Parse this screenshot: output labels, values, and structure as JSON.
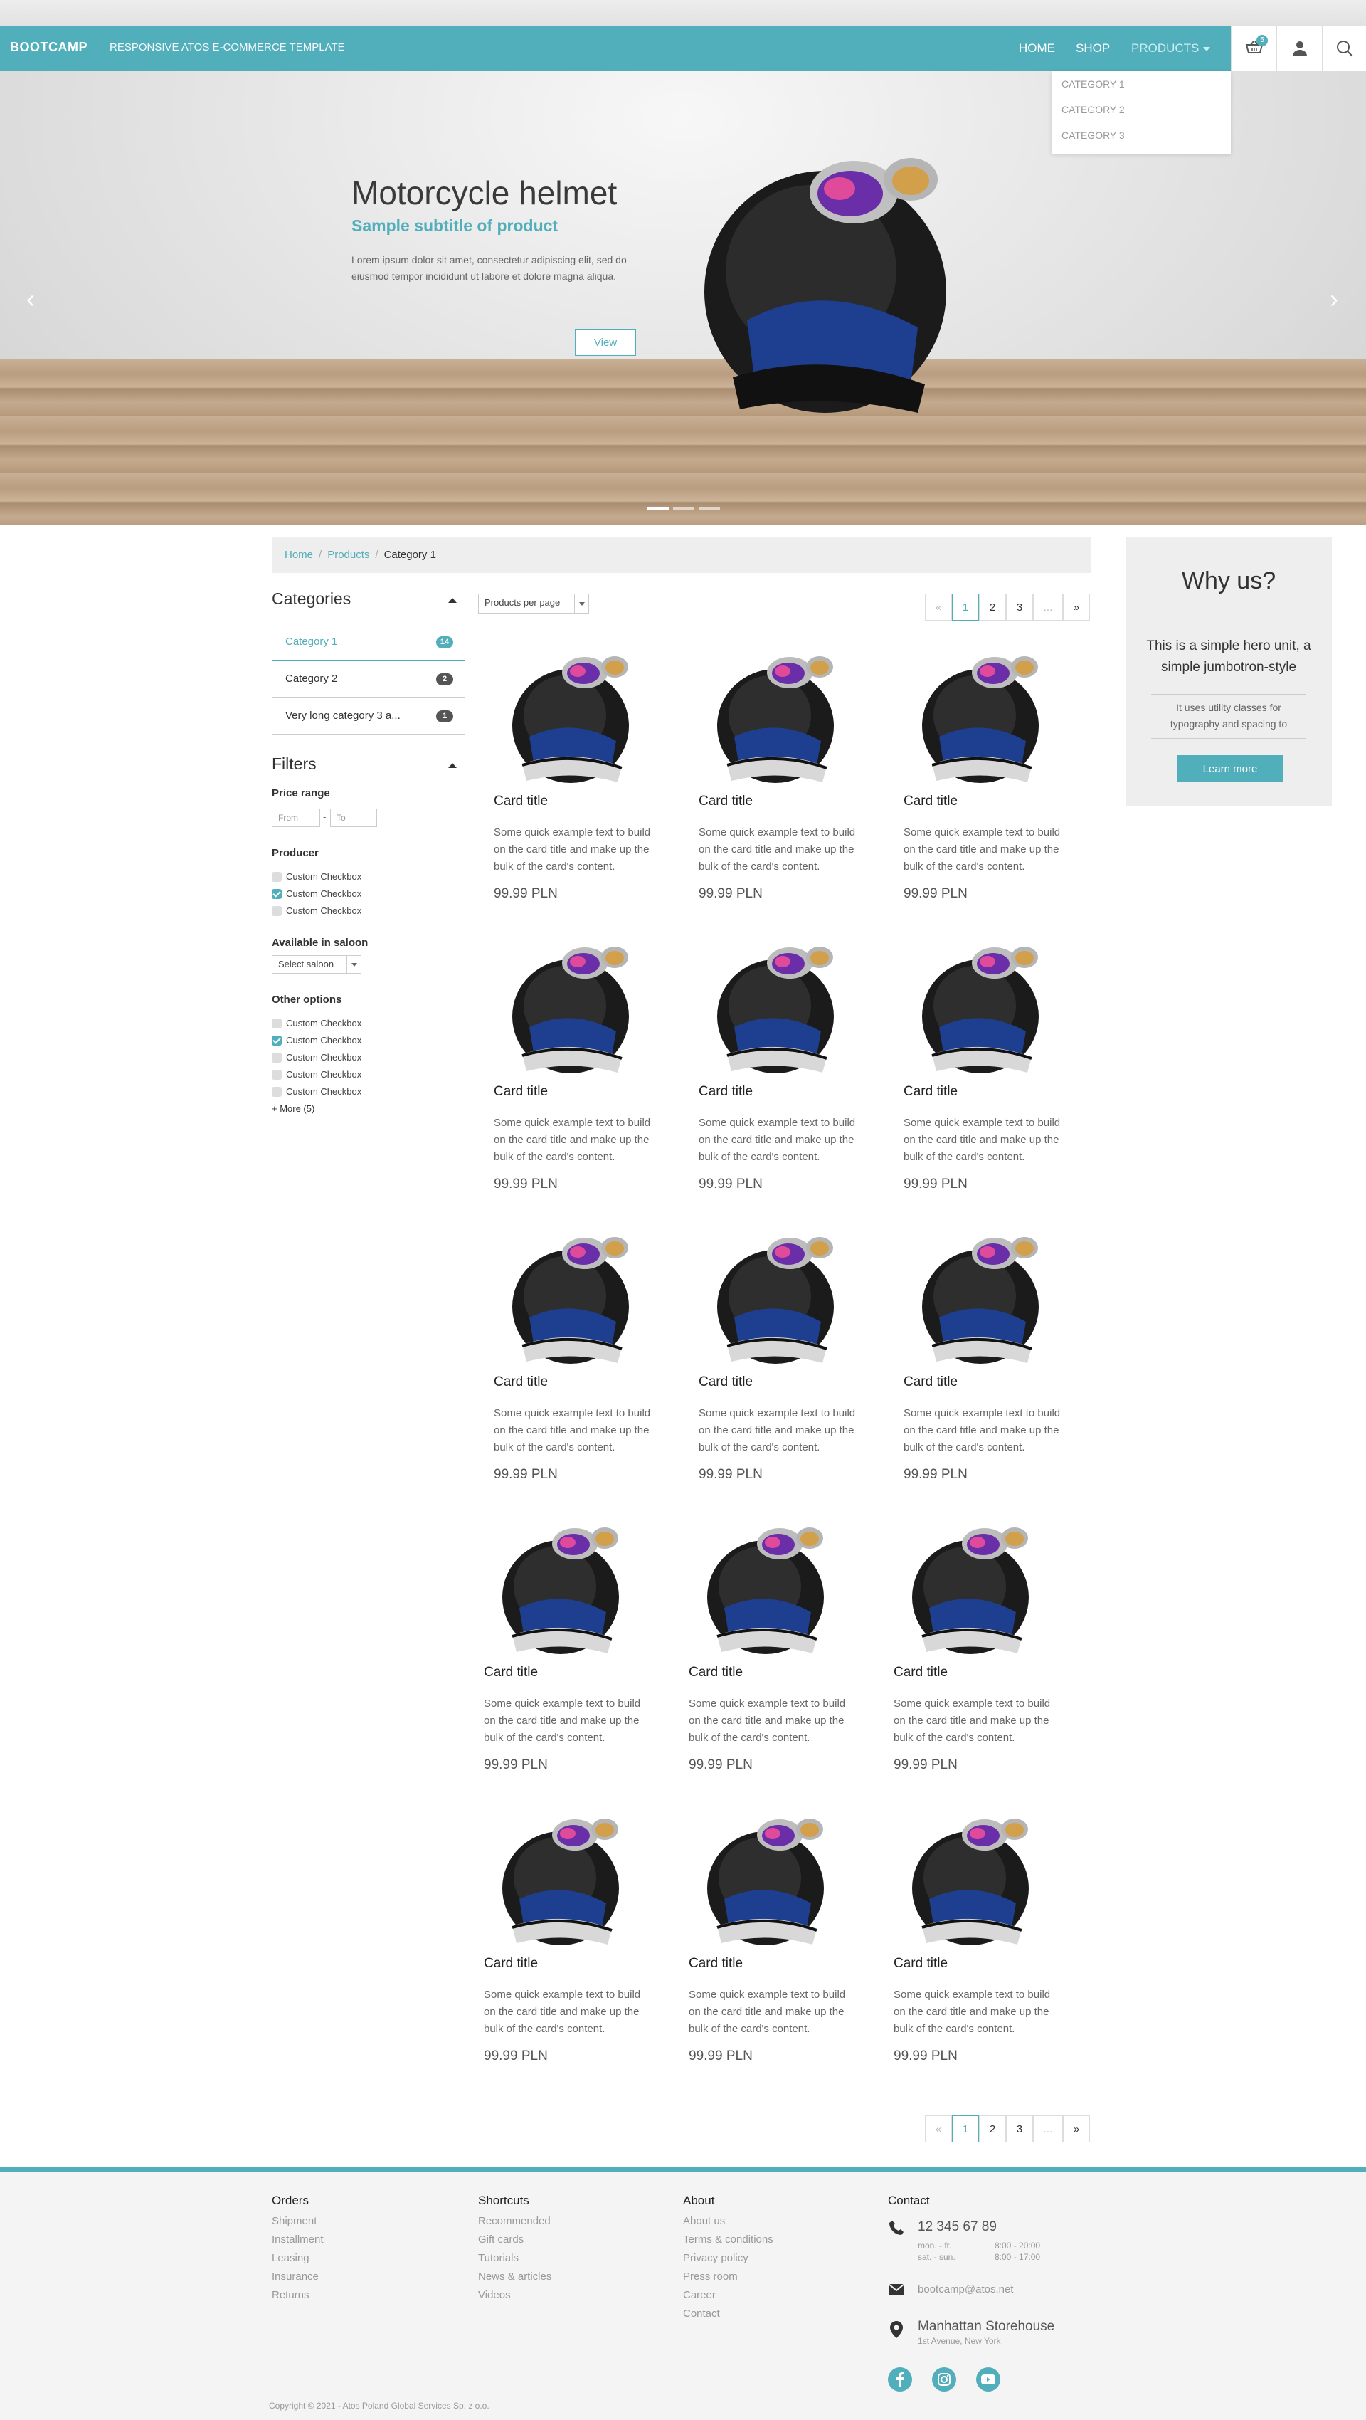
{
  "navbar": {
    "brand": "BOOTCAMP",
    "tagline": "RESPONSIVE ATOS E-COMMERCE TEMPLATE",
    "links": [
      "HOME",
      "SHOP",
      "PRODUCTS"
    ],
    "cart_count": "5",
    "products_dropdown": [
      "CATEGORY 1",
      "CATEGORY 2",
      "CATEGORY 3"
    ],
    "icons": [
      "cart-icon",
      "user-icon",
      "search-icon"
    ]
  },
  "hero": {
    "title": "Motorcycle helmet",
    "subtitle": "Sample subtitle of product",
    "text": "Lorem ipsum dolor sit amet, consectetur adipiscing elit, sed do eiusmod tempor incididunt ut labore et dolore magna aliqua.",
    "button": "View",
    "slide_count": 3,
    "active_slide": 1
  },
  "breadcrumb": [
    "Home",
    "Products",
    "Category 1"
  ],
  "sidebar": {
    "categories_title": "Categories",
    "categories": [
      {
        "label": "Category 1",
        "count": "14"
      },
      {
        "label": "Category 2",
        "count": "2"
      },
      {
        "label": "Very long category 3 a...",
        "count": "1"
      }
    ],
    "filters_title": "Filters",
    "price_range": {
      "label": "Price range",
      "from_placeholder": "From",
      "to_placeholder": "To",
      "separator": "-"
    },
    "producer": {
      "label": "Producer",
      "options": [
        {
          "label": "Custom Checkbox",
          "checked": false
        },
        {
          "label": "Custom Checkbox",
          "checked": true
        },
        {
          "label": "Custom Checkbox",
          "checked": false
        }
      ]
    },
    "saloon": {
      "label": "Available in saloon",
      "value": "Select saloon"
    },
    "other": {
      "label": "Other options",
      "options": [
        {
          "label": "Custom Checkbox",
          "checked": false
        },
        {
          "label": "Custom Checkbox",
          "checked": true
        },
        {
          "label": "Custom Checkbox",
          "checked": false
        },
        {
          "label": "Custom Checkbox",
          "checked": false
        },
        {
          "label": "Custom Checkbox",
          "checked": false
        }
      ],
      "more": "+ More (5)"
    }
  },
  "toolbar": {
    "per_page": "Products per page"
  },
  "pagination": {
    "prev": "«",
    "pages": [
      "1",
      "2",
      "3"
    ],
    "ellipsis": "...",
    "next": "»",
    "active": "1"
  },
  "products": [
    {
      "title": "Card title",
      "text": "Some quick example text to build on the card title and make up the bulk of the card's content.",
      "price": "99.99 PLN"
    },
    {
      "title": "Card title",
      "text": "Some quick example text to build on the card title and make up the bulk of the card's content.",
      "price": "99.99 PLN"
    },
    {
      "title": "Card title",
      "text": "Some quick example text to build on the card title and make up the bulk of the card's content.",
      "price": "99.99 PLN"
    },
    {
      "title": "Card title",
      "text": "Some quick example text to build on the card title and make up the bulk of the card's content.",
      "price": "99.99 PLN"
    },
    {
      "title": "Card title",
      "text": "Some quick example text to build on the card title and make up the bulk of the card's content.",
      "price": "99.99 PLN"
    },
    {
      "title": "Card title",
      "text": "Some quick example text to build on the card title and make up the bulk of the card's content.",
      "price": "99.99 PLN"
    },
    {
      "title": "Card title",
      "text": "Some quick example text to build on the card title and make up the bulk of the card's content.",
      "price": "99.99 PLN"
    },
    {
      "title": "Card title",
      "text": "Some quick example text to build on the card title and make up the bulk of the card's content.",
      "price": "99.99 PLN"
    },
    {
      "title": "Card title",
      "text": "Some quick example text to build on the card title and make up the bulk of the card's content.",
      "price": "99.99 PLN"
    },
    {
      "title": "Card title",
      "text": "Some quick example text to build on the card title and make up the bulk of the card's content.",
      "price": "99.99 PLN"
    },
    {
      "title": "Card title",
      "text": "Some quick example text to build on the card title and make up the bulk of the card's content.",
      "price": "99.99 PLN"
    },
    {
      "title": "Card title",
      "text": "Some quick example text to build on the card title and make up the bulk of the card's content.",
      "price": "99.99 PLN"
    },
    {
      "title": "Card title",
      "text": "Some quick example text to build on the card title and make up the bulk of the card's content.",
      "price": "99.99 PLN"
    },
    {
      "title": "Card title",
      "text": "Some quick example text to build on the card title and make up the bulk of the card's content.",
      "price": "99.99 PLN"
    },
    {
      "title": "Card title",
      "text": "Some quick example text to build on the card title and make up the bulk of the card's content.",
      "price": "99.99 PLN"
    }
  ],
  "why": {
    "title": "Why us?",
    "lead": "This is a simple hero unit, a simple jumbotron-style",
    "text": "It uses utility classes for typography and spacing to",
    "button": "Learn more"
  },
  "footer": {
    "columns": [
      {
        "title": "Orders",
        "links": [
          "Shipment",
          "Installment",
          "Leasing",
          "Insurance",
          "Returns"
        ]
      },
      {
        "title": "Shortcuts",
        "links": [
          "Recommended",
          "Gift cards",
          "Tutorials",
          "News & articles",
          "Videos"
        ]
      },
      {
        "title": "About",
        "links": [
          "About us",
          "Terms & conditions",
          "Privacy policy",
          "Press room",
          "Career",
          "Contact"
        ]
      }
    ],
    "contact": {
      "title": "Contact",
      "phone": "12 345 67 89",
      "hours": [
        [
          "mon. - fr.",
          "8:00 - 20:00"
        ],
        [
          "sat. - sun.",
          "8:00 - 17:00"
        ]
      ],
      "email": "bootcamp@atos.net",
      "place": "Manhattan Storehouse",
      "address": "1st Avenue, New York"
    },
    "social": [
      "facebook-icon",
      "instagram-icon",
      "youtube-icon"
    ],
    "copyright": "Copyright © 2021 - Atos Poland Global Services Sp. z o.o."
  },
  "colors": {
    "accent": "#51aebb",
    "footer_bg": "#f4f4f4",
    "panel_bg": "#eeeeee"
  }
}
